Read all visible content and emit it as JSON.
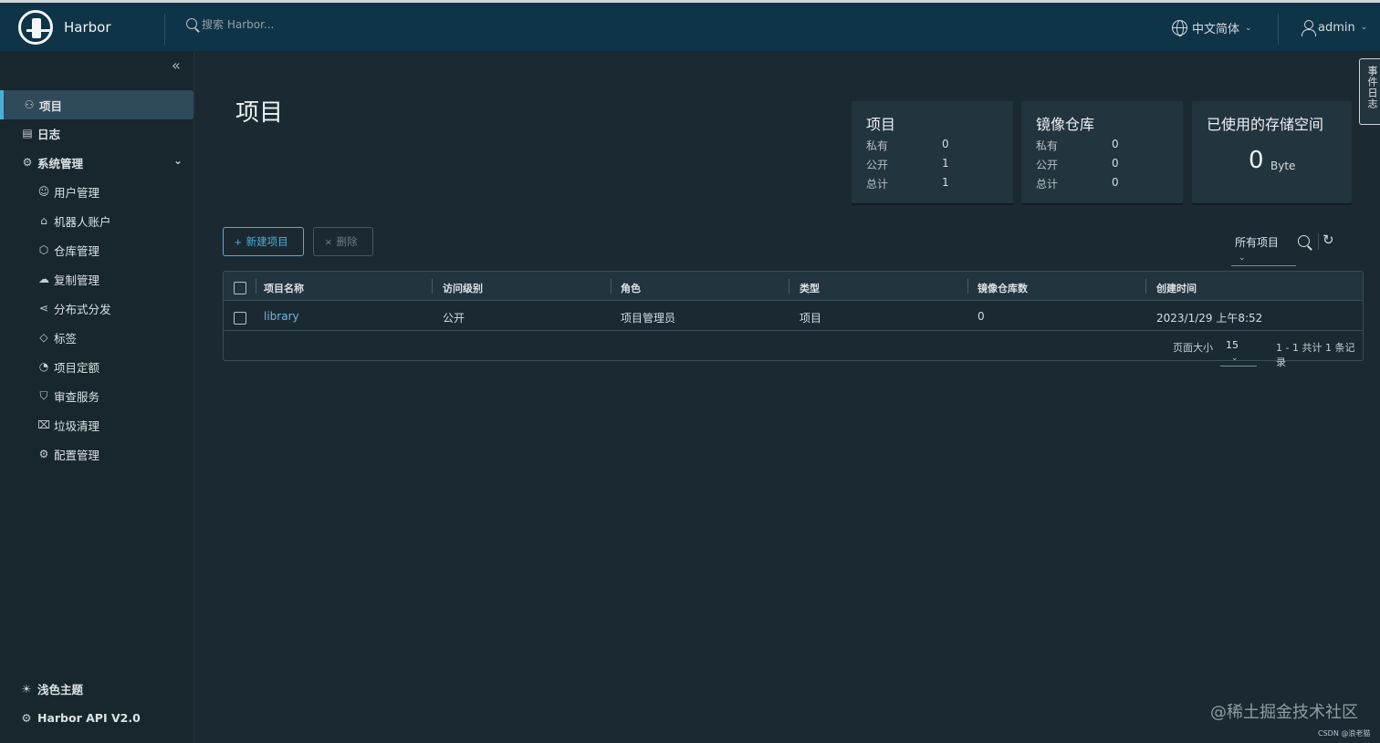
{
  "header": {
    "app_name": "Harbor",
    "search_placeholder": "搜索 Harbor...",
    "language": "中文简体",
    "user": "admin"
  },
  "sidebar": {
    "items": [
      {
        "label": "项目",
        "icon": "projects-icon",
        "active": true
      },
      {
        "label": "日志",
        "icon": "logs-icon"
      },
      {
        "label": "系统管理",
        "icon": "admin-icon",
        "expanded": true
      }
    ],
    "sub_items": [
      {
        "label": "用户管理",
        "icon": "users-icon"
      },
      {
        "label": "机器人账户",
        "icon": "robot-icon"
      },
      {
        "label": "仓库管理",
        "icon": "registry-icon"
      },
      {
        "label": "复制管理",
        "icon": "replication-icon"
      },
      {
        "label": "分布式分发",
        "icon": "share-icon"
      },
      {
        "label": "标签",
        "icon": "tag-icon"
      },
      {
        "label": "项目定额",
        "icon": "quota-icon"
      },
      {
        "label": "审查服务",
        "icon": "shield-icon"
      },
      {
        "label": "垃圾清理",
        "icon": "trash-icon"
      },
      {
        "label": "配置管理",
        "icon": "gear-icon"
      }
    ],
    "footer": {
      "theme": "浅色主题",
      "api": "Harbor API V2.0"
    }
  },
  "main": {
    "title": "项目",
    "cards": {
      "projects": {
        "title": "项目",
        "rows": [
          {
            "label": "私有",
            "value": "0"
          },
          {
            "label": "公开",
            "value": "1"
          },
          {
            "label": "总计",
            "value": "1"
          }
        ]
      },
      "repositories": {
        "title": "镜像仓库",
        "rows": [
          {
            "label": "私有",
            "value": "0"
          },
          {
            "label": "公开",
            "value": "0"
          },
          {
            "label": "总计",
            "value": "0"
          }
        ]
      },
      "storage": {
        "title": "已使用的存储空间",
        "value": "0",
        "unit": "Byte"
      }
    },
    "toolbar": {
      "new_project": "新建项目",
      "delete": "删除",
      "filter": "所有项目"
    },
    "table": {
      "columns": [
        "项目名称",
        "访问级别",
        "角色",
        "类型",
        "镜像仓库数",
        "创建时间"
      ],
      "rows": [
        {
          "name": "library",
          "access": "公开",
          "role": "项目管理员",
          "type": "项目",
          "repo_count": "0",
          "created": "2023/1/29 上午8:52"
        }
      ],
      "footer": {
        "page_size_label": "页面大小",
        "page_size": "15",
        "summary": "1 - 1 共计 1 条记录"
      }
    }
  },
  "side_tab": "事件日志",
  "watermark": {
    "main": "@稀土掘金技术社区",
    "small": "CSDN @浪老猫"
  },
  "colors": {
    "header_bg": "#0f3448",
    "sidebar_bg": "#18262e",
    "main_bg": "#1b2a32",
    "accent": "#49afd9",
    "card_bg": "#22343e"
  }
}
